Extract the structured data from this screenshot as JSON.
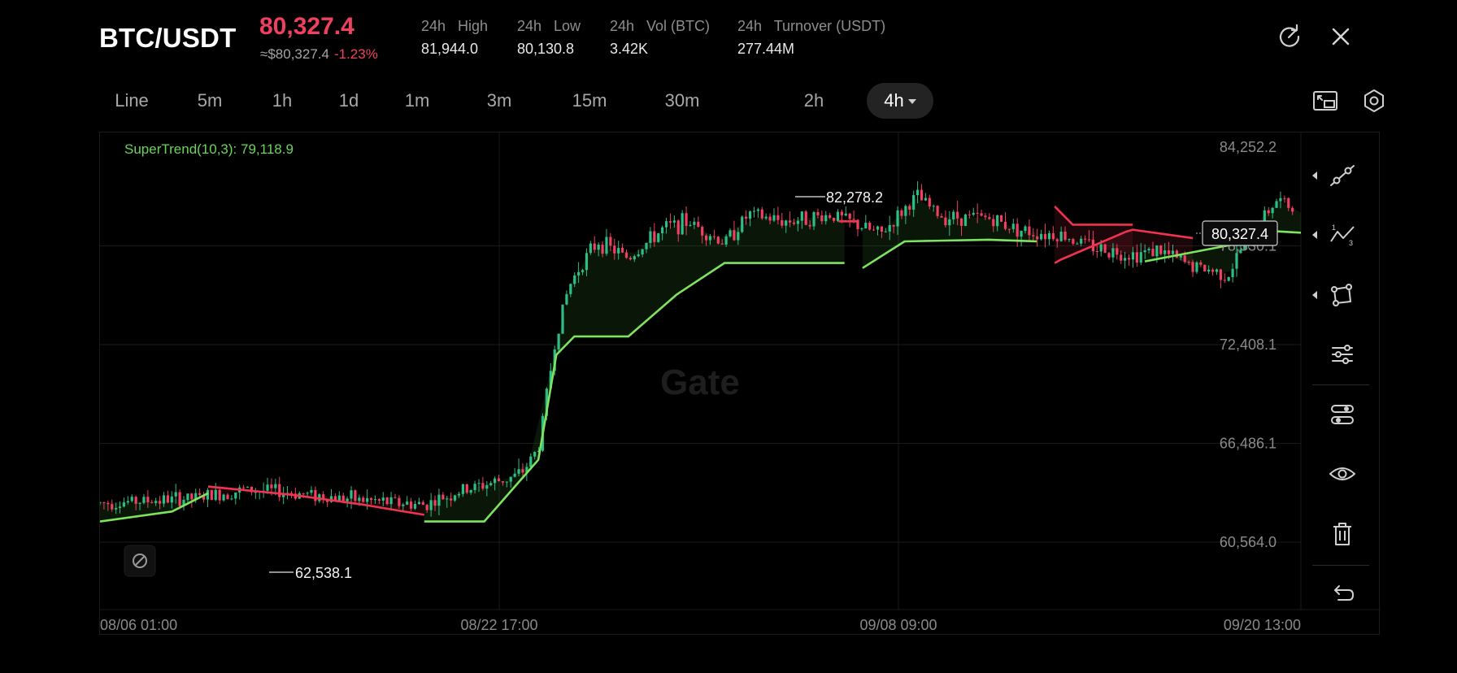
{
  "header": {
    "pair": "BTC/USDT",
    "last_price": "80,327.4",
    "approx_price": "≈$80,327.4",
    "change_pct": "-1.23%",
    "stats": [
      {
        "label": "24h   High",
        "value": "81,944.0"
      },
      {
        "label": "24h   Low",
        "value": "80,130.8"
      },
      {
        "label": "24h   Vol (BTC)",
        "value": "3.42K"
      },
      {
        "label": "24h   Turnover (USDT)",
        "value": "277.44M"
      }
    ],
    "actions": [
      {
        "icon": "refresh-icon"
      },
      {
        "icon": "close-icon"
      }
    ]
  },
  "intervals": {
    "tabs": [
      "Line",
      "5m",
      "1h",
      "1d",
      "1m",
      "3m",
      "15m",
      "30m",
      "2h",
      "4h"
    ],
    "active": "4h",
    "right_icons": [
      "picture-in-picture-icon",
      "settings-icon"
    ]
  },
  "chart": {
    "indicator_label": "SuperTrend(10,3): 79,118.9",
    "watermark": "Gate",
    "current_price_tag": "80,327.4",
    "high_marker": "82,278.2",
    "low_marker": "62,538.1",
    "x_labels": [
      "08/06 01:00",
      "08/22 17:00",
      "09/08 09:00",
      "09/20 13:00"
    ],
    "colors": {
      "up": "#2ebd85",
      "down": "#f0405f",
      "st_up": "#7ee35f",
      "st_down": "#f0334f",
      "grid": "#1a1a1a",
      "axis_text": "#8a8a8a"
    }
  },
  "toolbar": {
    "icons": [
      "trend-line-icon",
      "fibonacci-icon",
      "shape-icon",
      "indicator-settings-icon",
      "drawing-settings-icon",
      "eye-icon",
      "trash-icon",
      "undo-icon"
    ]
  },
  "chart_data": {
    "type": "candlestick",
    "title": "",
    "indicator": "SuperTrend(10,3)",
    "ylim": [
      60564.0,
      84252.2
    ],
    "y_ticks": [
      84252.2,
      78330.1,
      72408.1,
      66486.1,
      60564.0
    ],
    "x_ticks": [
      "08/06 01:00",
      "08/22 17:00",
      "09/08 09:00",
      "09/20 13:00"
    ],
    "grid": true,
    "last_price": 80327.4,
    "period_high": 82278.2,
    "period_low": 62538.1,
    "supertrend_last": 79118.9,
    "close_trend": [
      [
        0,
        62900
      ],
      [
        8,
        63200
      ],
      [
        12,
        63700
      ],
      [
        15,
        63600
      ],
      [
        19,
        63300
      ],
      [
        23,
        63000
      ],
      [
        27,
        62800
      ],
      [
        30,
        63600
      ],
      [
        33,
        64200
      ],
      [
        35,
        64600
      ],
      [
        36.5,
        66200
      ],
      [
        37.2,
        69500
      ],
      [
        38,
        73000
      ],
      [
        39,
        75800
      ],
      [
        40,
        77200
      ],
      [
        41.5,
        78600
      ],
      [
        44,
        77600
      ],
      [
        47,
        79400
      ],
      [
        49,
        79800
      ],
      [
        52,
        78500
      ],
      [
        54,
        80200
      ],
      [
        57,
        79800
      ],
      [
        61,
        80200
      ],
      [
        65,
        79000
      ],
      [
        68,
        81300
      ],
      [
        70,
        80100
      ],
      [
        74,
        80000
      ],
      [
        77,
        79200
      ],
      [
        80,
        79000
      ],
      [
        83,
        78200
      ],
      [
        86,
        77800
      ],
      [
        88,
        78100
      ],
      [
        91,
        77100
      ],
      [
        94,
        76600
      ],
      [
        95.5,
        78900
      ],
      [
        98,
        81100
      ],
      [
        100,
        80327.4
      ]
    ],
    "supertrend": [
      [
        0,
        61800,
        "up"
      ],
      [
        6,
        62400,
        "up"
      ],
      [
        9,
        63500,
        "up"
      ],
      [
        9,
        63900,
        "down"
      ],
      [
        16,
        63400,
        "down"
      ],
      [
        22,
        62800,
        "down"
      ],
      [
        27,
        62200,
        "down"
      ],
      [
        27,
        61800,
        "up"
      ],
      [
        32,
        61800,
        "up"
      ],
      [
        36.5,
        65500,
        "up"
      ],
      [
        38,
        71800,
        "up"
      ],
      [
        39.5,
        72900,
        "up"
      ],
      [
        44,
        72900,
        "up"
      ],
      [
        48,
        75400,
        "up"
      ],
      [
        52,
        77300,
        "up"
      ],
      [
        57,
        77300,
        "up"
      ],
      [
        62,
        77300,
        "up"
      ],
      [
        61.5,
        79800,
        "down"
      ],
      [
        63,
        79800,
        "down"
      ],
      [
        63.5,
        77000,
        "up"
      ],
      [
        67,
        78600,
        "up"
      ],
      [
        74,
        78700,
        "up"
      ],
      [
        78,
        78600,
        "up"
      ],
      [
        79.5,
        80700,
        "down"
      ],
      [
        81,
        79600,
        "down"
      ],
      [
        86,
        79600,
        "down"
      ],
      [
        79.5,
        77300,
        "down"
      ],
      [
        80,
        77500,
        "down"
      ],
      [
        85.5,
        79200,
        "down"
      ],
      [
        86,
        79300,
        "down"
      ],
      [
        91,
        78800,
        "down"
      ],
      [
        87,
        77400,
        "up"
      ],
      [
        95,
        78500,
        "up"
      ],
      [
        95.5,
        79300,
        "up"
      ],
      [
        100,
        79118.9,
        "up"
      ]
    ]
  }
}
